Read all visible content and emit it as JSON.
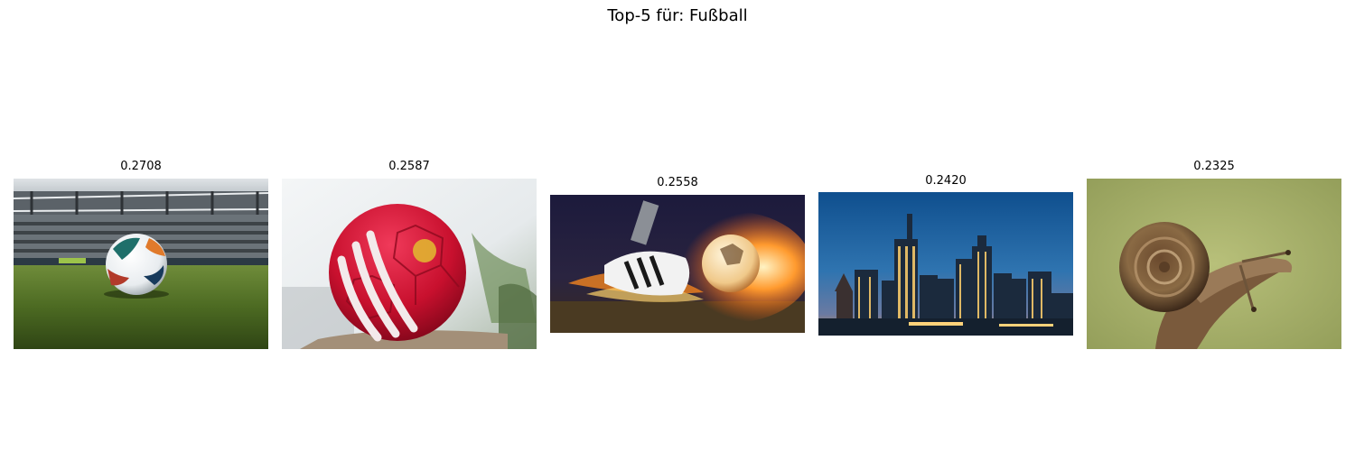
{
  "title": "Top-5 für: Fußball",
  "results": [
    {
      "rank": 1,
      "score": "0.2708",
      "image": "soccer-ball-on-stadium-grass"
    },
    {
      "rank": 2,
      "score": "0.2587",
      "image": "red-soccer-ball-on-rock"
    },
    {
      "rank": 3,
      "score": "0.2558",
      "image": "football-boot-kicking-flaming-ball"
    },
    {
      "rank": 4,
      "score": "0.2420",
      "image": "frankfurt-skyline-at-dusk"
    },
    {
      "rank": 5,
      "score": "0.2325",
      "image": "snail-on-branch"
    }
  ]
}
